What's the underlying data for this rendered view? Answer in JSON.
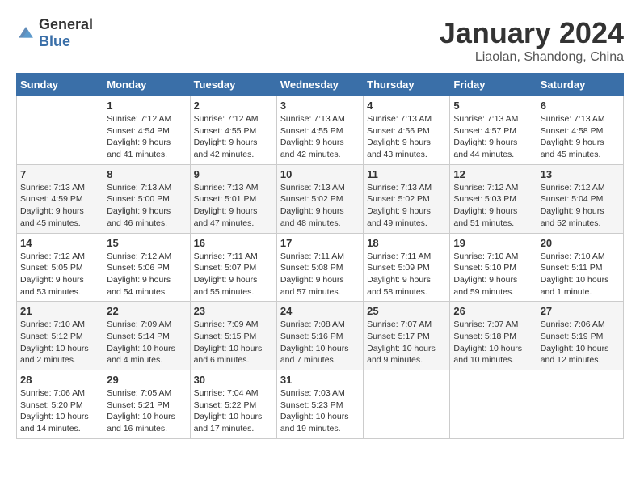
{
  "logo": {
    "text_general": "General",
    "text_blue": "Blue"
  },
  "header": {
    "month_year": "January 2024",
    "location": "Liaolan, Shandong, China"
  },
  "weekdays": [
    "Sunday",
    "Monday",
    "Tuesday",
    "Wednesday",
    "Thursday",
    "Friday",
    "Saturday"
  ],
  "weeks": [
    [
      {
        "day": "",
        "sunrise": "",
        "sunset": "",
        "daylight": ""
      },
      {
        "day": "1",
        "sunrise": "Sunrise: 7:12 AM",
        "sunset": "Sunset: 4:54 PM",
        "daylight": "Daylight: 9 hours and 41 minutes."
      },
      {
        "day": "2",
        "sunrise": "Sunrise: 7:12 AM",
        "sunset": "Sunset: 4:55 PM",
        "daylight": "Daylight: 9 hours and 42 minutes."
      },
      {
        "day": "3",
        "sunrise": "Sunrise: 7:13 AM",
        "sunset": "Sunset: 4:55 PM",
        "daylight": "Daylight: 9 hours and 42 minutes."
      },
      {
        "day": "4",
        "sunrise": "Sunrise: 7:13 AM",
        "sunset": "Sunset: 4:56 PM",
        "daylight": "Daylight: 9 hours and 43 minutes."
      },
      {
        "day": "5",
        "sunrise": "Sunrise: 7:13 AM",
        "sunset": "Sunset: 4:57 PM",
        "daylight": "Daylight: 9 hours and 44 minutes."
      },
      {
        "day": "6",
        "sunrise": "Sunrise: 7:13 AM",
        "sunset": "Sunset: 4:58 PM",
        "daylight": "Daylight: 9 hours and 45 minutes."
      }
    ],
    [
      {
        "day": "7",
        "sunrise": "Sunrise: 7:13 AM",
        "sunset": "Sunset: 4:59 PM",
        "daylight": "Daylight: 9 hours and 45 minutes."
      },
      {
        "day": "8",
        "sunrise": "Sunrise: 7:13 AM",
        "sunset": "Sunset: 5:00 PM",
        "daylight": "Daylight: 9 hours and 46 minutes."
      },
      {
        "day": "9",
        "sunrise": "Sunrise: 7:13 AM",
        "sunset": "Sunset: 5:01 PM",
        "daylight": "Daylight: 9 hours and 47 minutes."
      },
      {
        "day": "10",
        "sunrise": "Sunrise: 7:13 AM",
        "sunset": "Sunset: 5:02 PM",
        "daylight": "Daylight: 9 hours and 48 minutes."
      },
      {
        "day": "11",
        "sunrise": "Sunrise: 7:13 AM",
        "sunset": "Sunset: 5:02 PM",
        "daylight": "Daylight: 9 hours and 49 minutes."
      },
      {
        "day": "12",
        "sunrise": "Sunrise: 7:12 AM",
        "sunset": "Sunset: 5:03 PM",
        "daylight": "Daylight: 9 hours and 51 minutes."
      },
      {
        "day": "13",
        "sunrise": "Sunrise: 7:12 AM",
        "sunset": "Sunset: 5:04 PM",
        "daylight": "Daylight: 9 hours and 52 minutes."
      }
    ],
    [
      {
        "day": "14",
        "sunrise": "Sunrise: 7:12 AM",
        "sunset": "Sunset: 5:05 PM",
        "daylight": "Daylight: 9 hours and 53 minutes."
      },
      {
        "day": "15",
        "sunrise": "Sunrise: 7:12 AM",
        "sunset": "Sunset: 5:06 PM",
        "daylight": "Daylight: 9 hours and 54 minutes."
      },
      {
        "day": "16",
        "sunrise": "Sunrise: 7:11 AM",
        "sunset": "Sunset: 5:07 PM",
        "daylight": "Daylight: 9 hours and 55 minutes."
      },
      {
        "day": "17",
        "sunrise": "Sunrise: 7:11 AM",
        "sunset": "Sunset: 5:08 PM",
        "daylight": "Daylight: 9 hours and 57 minutes."
      },
      {
        "day": "18",
        "sunrise": "Sunrise: 7:11 AM",
        "sunset": "Sunset: 5:09 PM",
        "daylight": "Daylight: 9 hours and 58 minutes."
      },
      {
        "day": "19",
        "sunrise": "Sunrise: 7:10 AM",
        "sunset": "Sunset: 5:10 PM",
        "daylight": "Daylight: 9 hours and 59 minutes."
      },
      {
        "day": "20",
        "sunrise": "Sunrise: 7:10 AM",
        "sunset": "Sunset: 5:11 PM",
        "daylight": "Daylight: 10 hours and 1 minute."
      }
    ],
    [
      {
        "day": "21",
        "sunrise": "Sunrise: 7:10 AM",
        "sunset": "Sunset: 5:12 PM",
        "daylight": "Daylight: 10 hours and 2 minutes."
      },
      {
        "day": "22",
        "sunrise": "Sunrise: 7:09 AM",
        "sunset": "Sunset: 5:14 PM",
        "daylight": "Daylight: 10 hours and 4 minutes."
      },
      {
        "day": "23",
        "sunrise": "Sunrise: 7:09 AM",
        "sunset": "Sunset: 5:15 PM",
        "daylight": "Daylight: 10 hours and 6 minutes."
      },
      {
        "day": "24",
        "sunrise": "Sunrise: 7:08 AM",
        "sunset": "Sunset: 5:16 PM",
        "daylight": "Daylight: 10 hours and 7 minutes."
      },
      {
        "day": "25",
        "sunrise": "Sunrise: 7:07 AM",
        "sunset": "Sunset: 5:17 PM",
        "daylight": "Daylight: 10 hours and 9 minutes."
      },
      {
        "day": "26",
        "sunrise": "Sunrise: 7:07 AM",
        "sunset": "Sunset: 5:18 PM",
        "daylight": "Daylight: 10 hours and 10 minutes."
      },
      {
        "day": "27",
        "sunrise": "Sunrise: 7:06 AM",
        "sunset": "Sunset: 5:19 PM",
        "daylight": "Daylight: 10 hours and 12 minutes."
      }
    ],
    [
      {
        "day": "28",
        "sunrise": "Sunrise: 7:06 AM",
        "sunset": "Sunset: 5:20 PM",
        "daylight": "Daylight: 10 hours and 14 minutes."
      },
      {
        "day": "29",
        "sunrise": "Sunrise: 7:05 AM",
        "sunset": "Sunset: 5:21 PM",
        "daylight": "Daylight: 10 hours and 16 minutes."
      },
      {
        "day": "30",
        "sunrise": "Sunrise: 7:04 AM",
        "sunset": "Sunset: 5:22 PM",
        "daylight": "Daylight: 10 hours and 17 minutes."
      },
      {
        "day": "31",
        "sunrise": "Sunrise: 7:03 AM",
        "sunset": "Sunset: 5:23 PM",
        "daylight": "Daylight: 10 hours and 19 minutes."
      },
      {
        "day": "",
        "sunrise": "",
        "sunset": "",
        "daylight": ""
      },
      {
        "day": "",
        "sunrise": "",
        "sunset": "",
        "daylight": ""
      },
      {
        "day": "",
        "sunrise": "",
        "sunset": "",
        "daylight": ""
      }
    ]
  ]
}
